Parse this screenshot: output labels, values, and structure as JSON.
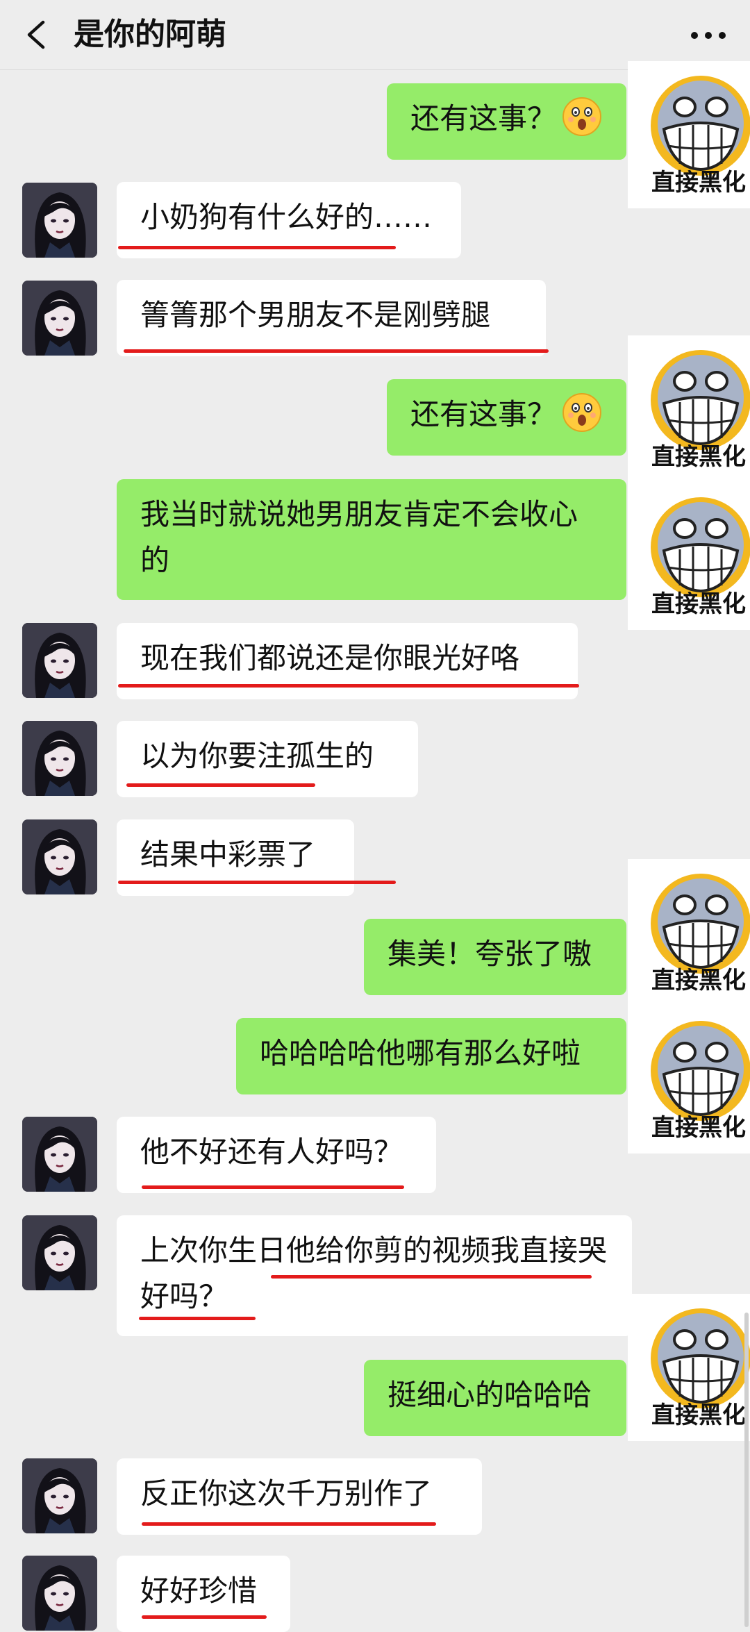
{
  "header": {
    "title": "是你的阿萌",
    "back_icon": "chevron-left-icon",
    "more_icon": "more-dots-icon"
  },
  "sticker": {
    "caption": "直接黑化"
  },
  "messages": [
    {
      "side": "out",
      "text": "还有这事？",
      "emoji": "shocked-face"
    },
    {
      "side": "in",
      "text": "小奶狗有什么好的……"
    },
    {
      "side": "in",
      "text": "箐箐那个男朋友不是刚劈腿"
    },
    {
      "side": "out",
      "text": "还有这事？",
      "emoji": "shocked-face"
    },
    {
      "side": "out",
      "text": "我当时就说她男朋友肯定不会收心的"
    },
    {
      "side": "in",
      "text": "现在我们都说还是你眼光好咯"
    },
    {
      "side": "in",
      "text": "以为你要注孤生的"
    },
    {
      "side": "in",
      "text": "结果中彩票了"
    },
    {
      "side": "out",
      "text": "集美！夸张了嗷"
    },
    {
      "side": "out",
      "text": "哈哈哈哈他哪有那么好啦"
    },
    {
      "side": "in",
      "text": "他不好还有人好吗？"
    },
    {
      "side": "in",
      "text": "上次你生日他给你剪的视频我直接哭好吗？"
    },
    {
      "side": "out",
      "text": "挺细心的哈哈哈"
    },
    {
      "side": "in",
      "text": "反正你这次千万别作了"
    },
    {
      "side": "in",
      "text": "好好珍惜"
    }
  ],
  "colors": {
    "background": "#ededed",
    "outgoing_bubble": "#95ec69",
    "incoming_bubble": "#ffffff",
    "annotation_underline": "#e31b1b"
  }
}
